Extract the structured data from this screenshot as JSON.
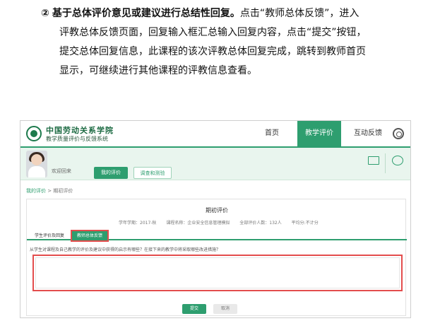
{
  "instruction": {
    "step_number": "②",
    "bold_heading": "基于总体评价意见或建议进行总结性回复。",
    "line1_rest": "点击“教师总体反馈”，进入",
    "line2": "评教总体反馈页面，回复输入框汇总输入回复内容，点击“提交”按钮，",
    "line3": "提交总体回复信息，此课程的该次评教总体回复完成，跳转到教师首页",
    "line4": "显示，可继续进行其他课程的评教信息查看。"
  },
  "app": {
    "logo_title": "中国劳动关系学院",
    "logo_subtitle": "教学质量评价与反馈系统",
    "nav": {
      "home": "首页",
      "teaching_eval": "教学评价",
      "interaction": "互动反馈"
    }
  },
  "profile": {
    "welcome": "欢迎回来",
    "tab_my_eval": "我的评价",
    "tab_survey": "调查和测验"
  },
  "breadcrumb": {
    "root": "我的评价",
    "separator": ">",
    "current": "期初评价"
  },
  "card": {
    "title": "期初评价",
    "semester": "学年学期：2017-秋",
    "course": "课程名称：企业安全信息管理模拟",
    "total_count": "全部评价人数：132人",
    "average": "平均分:不计分",
    "subtab_student": "学生评价及回复",
    "subtab_summary": "教师总体反馈",
    "question": "从学生对课程及自己教学的评价及建议中获得的启示有哪些？在接下来的教学中将采取哪些改进措施？",
    "submit_label": "提交",
    "cancel_label": "取消"
  },
  "colors": {
    "brand_green": "#2e9e6f",
    "highlight_red": "#e34d4d"
  }
}
